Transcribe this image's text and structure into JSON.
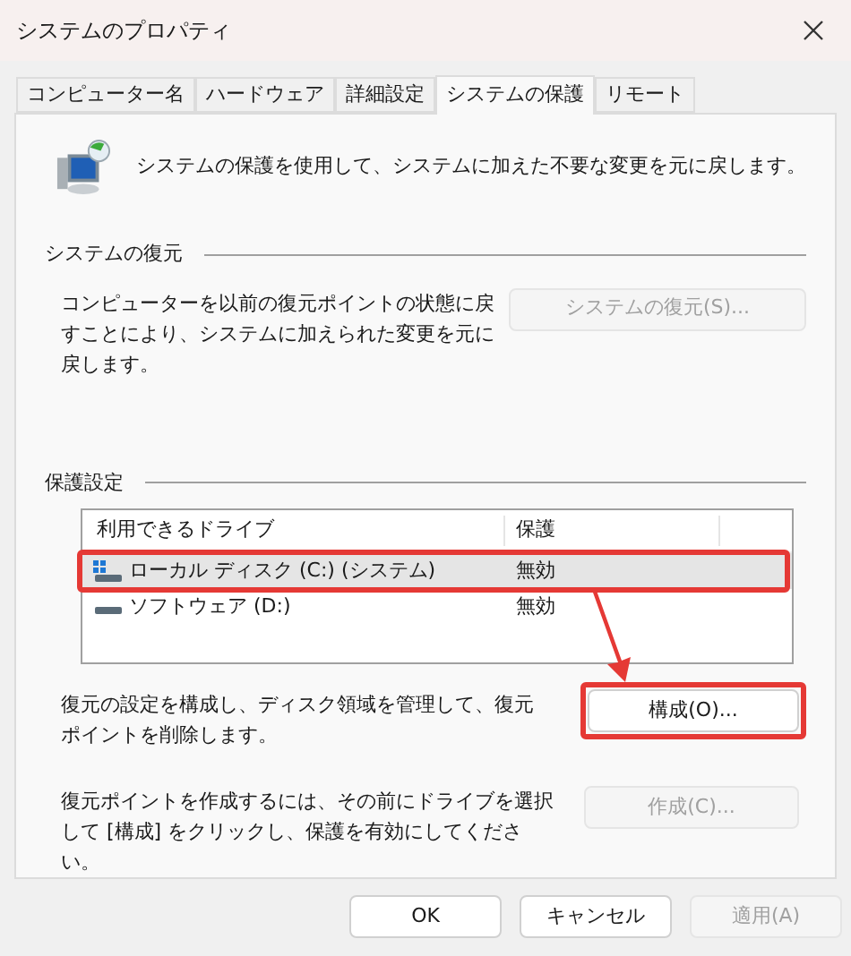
{
  "window": {
    "title": "システムのプロパティ"
  },
  "tabs": [
    {
      "label": "コンピューター名",
      "selected": false
    },
    {
      "label": "ハードウェア",
      "selected": false
    },
    {
      "label": "詳細設定",
      "selected": false
    },
    {
      "label": "システムの保護",
      "selected": true
    },
    {
      "label": "リモート",
      "selected": false
    }
  ],
  "intro": "システムの保護を使用して、システムに加えた不要な変更を元に戻します。",
  "restore": {
    "heading": "システムの復元",
    "text": "コンピューターを以前の復元ポイントの状態に戻すことにより、システムに加えられた変更を元に戻します。",
    "button": {
      "label": "システムの復元(S)...",
      "disabled": true
    }
  },
  "protection": {
    "heading": "保護設定",
    "columns": [
      "利用できるドライブ",
      "保護"
    ],
    "rows": [
      {
        "drive": "ローカル ディスク (C:) (システム)",
        "kind": "system",
        "status": "無効",
        "selected": true
      },
      {
        "drive": "ソフトウェア (D:)",
        "kind": "data",
        "status": "無効",
        "selected": false
      }
    ],
    "configure_text": "復元の設定を構成し、ディスク領域を管理して、復元ポイントを削除します。",
    "configure_button": {
      "label": "構成(O)...",
      "disabled": false
    },
    "create_text": "復元ポイントを作成するには、その前にドライブを選択して [構成] をクリックし、保護を有効にしてください。",
    "create_button": {
      "label": "作成(C)...",
      "disabled": true
    }
  },
  "buttons": [
    {
      "label": "OK",
      "disabled": false
    },
    {
      "label": "キャンセル",
      "disabled": false
    },
    {
      "label": "適用(A)",
      "disabled": true
    }
  ]
}
